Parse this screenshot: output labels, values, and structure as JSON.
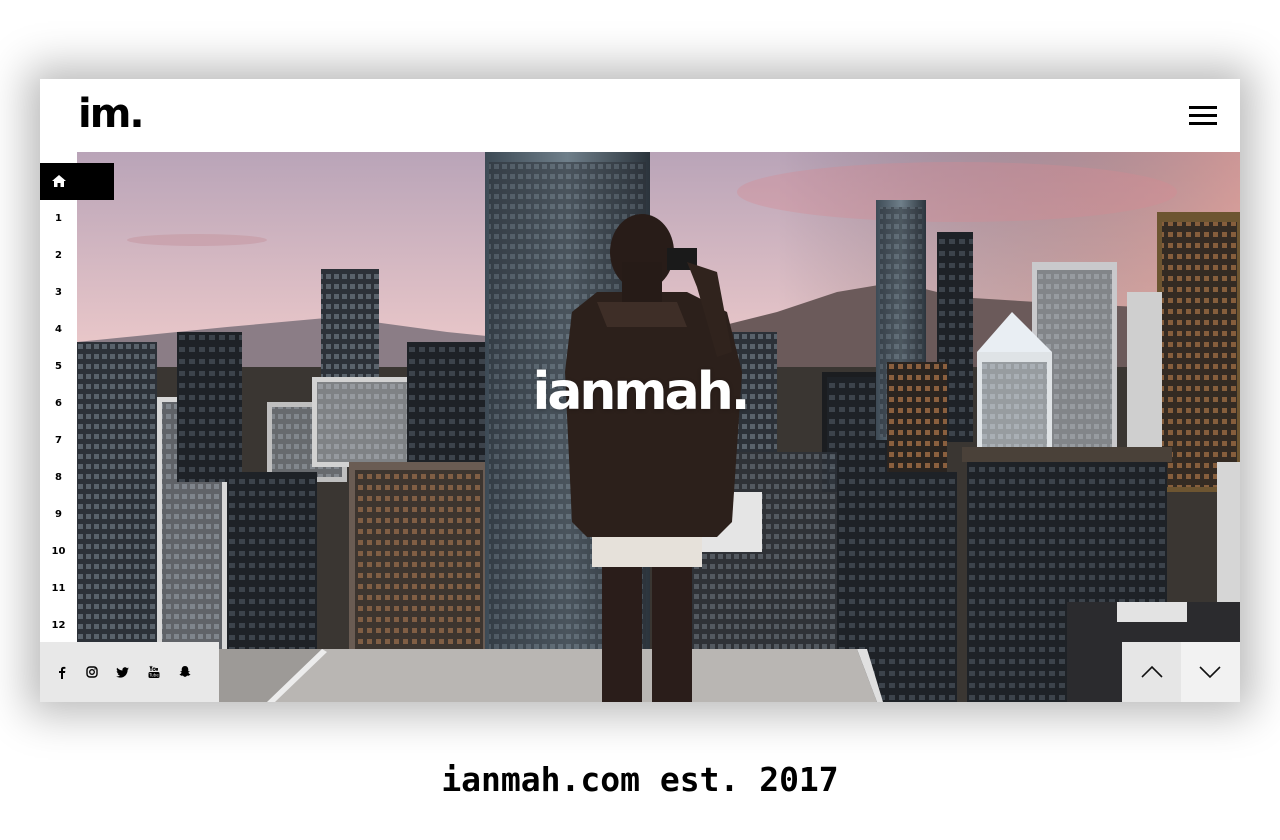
{
  "header": {
    "logo_text": "im.",
    "menu_icon": "hamburger-menu-icon"
  },
  "hero": {
    "title": "ianmah.",
    "background": "city-rooftop-photographer-photo"
  },
  "side_nav": {
    "home_icon": "home-icon",
    "items": [
      "1",
      "2",
      "3",
      "4",
      "5",
      "6",
      "7",
      "8",
      "9",
      "10",
      "11",
      "12"
    ]
  },
  "socials": {
    "icons": [
      "facebook-icon",
      "instagram-icon",
      "twitter-icon",
      "youtube-icon",
      "snapchat-icon"
    ]
  },
  "pager": {
    "up_icon": "chevron-up-icon",
    "down_icon": "chevron-down-icon"
  },
  "caption": "ianmah.com est. 2017",
  "colors": {
    "accent": "#000000",
    "panel": "#e8e8e8"
  }
}
